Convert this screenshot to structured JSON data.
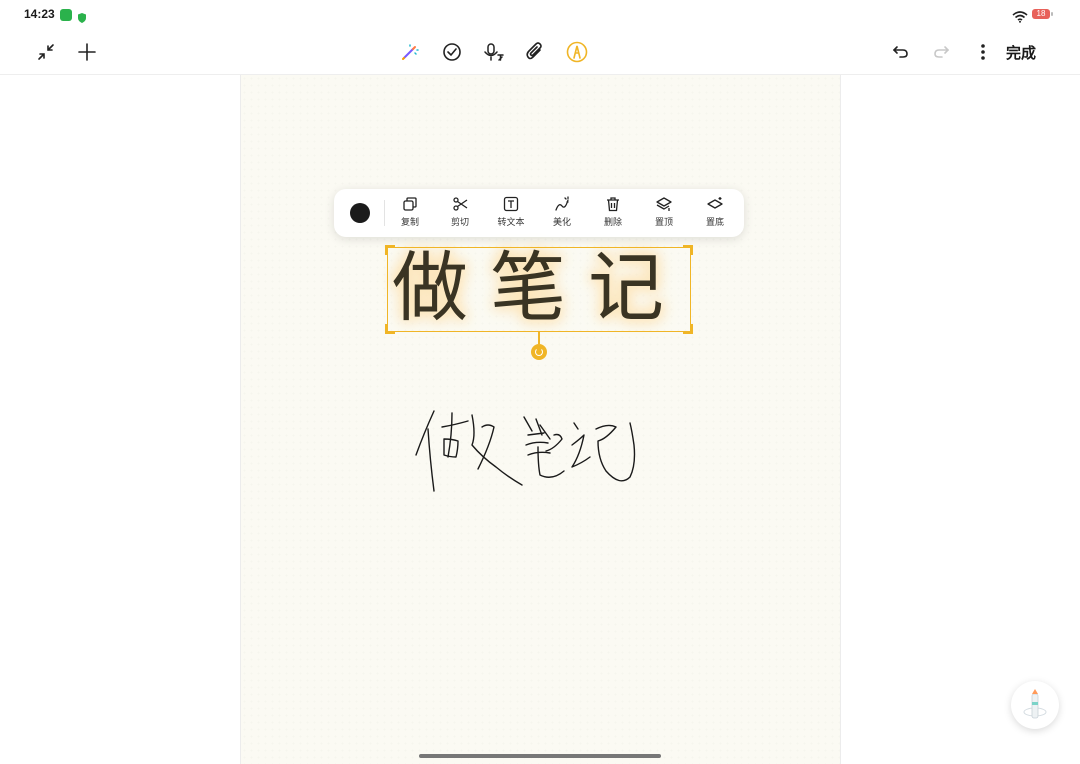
{
  "status_bar": {
    "time": "14:23",
    "battery": "18",
    "battery_color": "#e8615a"
  },
  "toolbar": {
    "left_icons": [
      "collapse-icon",
      "add-icon"
    ],
    "center_icons": [
      "magic-pen-icon",
      "checkmark-icon",
      "voice-to-text-icon",
      "attachment-icon",
      "pen-tool-icon"
    ],
    "right_icons": [
      "undo-icon",
      "redo-icon",
      "more-icon"
    ],
    "done_label": "完成",
    "active_tool_color": "#f0b526"
  },
  "selection_toolbar": {
    "selected_color": "#1b1b1b",
    "tools": [
      {
        "label": "复制",
        "icon": "copy-icon"
      },
      {
        "label": "剪切",
        "icon": "scissors-icon"
      },
      {
        "label": "转文本",
        "icon": "text-convert-icon"
      },
      {
        "label": "美化",
        "icon": "beautify-icon"
      },
      {
        "label": "删除",
        "icon": "trash-icon"
      },
      {
        "label": "置顶",
        "icon": "bring-to-front-icon"
      },
      {
        "label": "置底",
        "icon": "send-to-back-icon"
      }
    ]
  },
  "canvas": {
    "selected_text": "做笔记",
    "selection_color": "#f0b526",
    "highlight_color": "#fde6ba"
  }
}
